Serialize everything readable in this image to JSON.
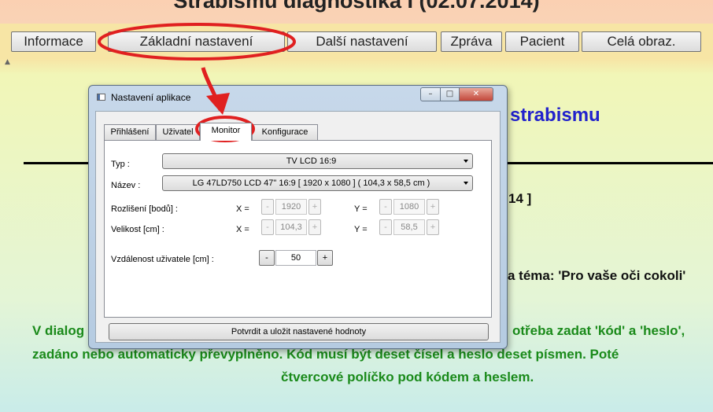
{
  "app": {
    "title": "Strabismu diagnostika I (02.07.2014)"
  },
  "menu": {
    "items": [
      {
        "label": "Informace"
      },
      {
        "label": "Základní nastavení"
      },
      {
        "label": "Další nastavení"
      },
      {
        "label": "Zpráva"
      },
      {
        "label": "Pacient"
      },
      {
        "label": "Celá obraz."
      }
    ]
  },
  "background": {
    "heading_fragment": "strabismu",
    "date_fragment": "14 ]",
    "theme_fragment": "a téma: 'Pro vaše oči cokoli'",
    "info_line1_left": "V dialog",
    "info_line1_right": "otřeba zadat 'kód' a 'heslo',",
    "info_line2": "zadáno nebo automaticky převyplněno. Kód musí být deset čísel a heslo deset písmen. Poté",
    "info_line3": "čtvercové políčko pod kódem a heslem."
  },
  "dialog": {
    "title": "Nastavení aplikace",
    "window_buttons": {
      "minimize": "–",
      "maximize": "□",
      "close": "✕"
    },
    "tabs": [
      {
        "label": "Přihlášení"
      },
      {
        "label": "Uživatel"
      },
      {
        "label": "Monitor",
        "active": true
      },
      {
        "label": "Konfigurace"
      }
    ],
    "monitor": {
      "type_label": "Typ :",
      "type_value": "TV LCD 16:9",
      "name_label": "Název :",
      "name_value": "LG 47LD750 LCD 47\" 16:9 [ 1920 x 1080 ] ( 104,3 x 58,5 cm )",
      "resolution_label": "Rozlišení [bodů] :",
      "size_label": "Velikost [cm] :",
      "x_label": "X =",
      "y_label": "Y =",
      "res_x": "1920",
      "res_y": "1080",
      "size_x": "104,3",
      "size_y": "58,5",
      "distance_label": "Vzdálenost uživatele [cm] :",
      "distance_value": "50",
      "minus": "-",
      "plus": "+"
    },
    "save_label": "Potvrdit a uložit nastavené hodnoty"
  },
  "colors": {
    "annotation": "#e02020",
    "heading_blue": "#2222cc",
    "info_green": "#1a8a1a"
  }
}
